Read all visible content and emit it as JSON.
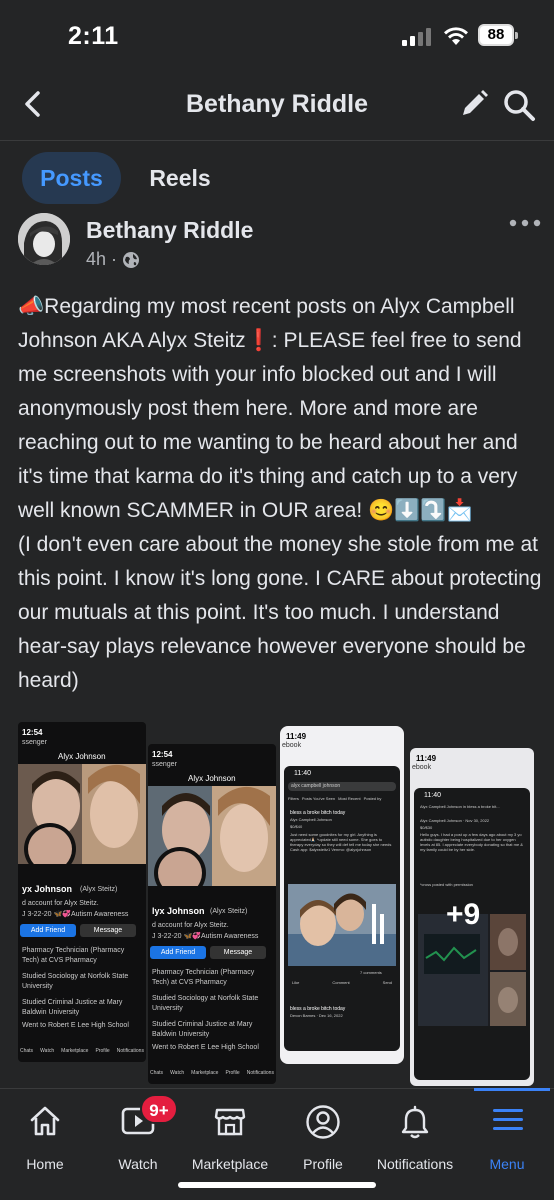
{
  "status_bar": {
    "time": "2:11",
    "battery": "88"
  },
  "header": {
    "title": "Bethany Riddle"
  },
  "tabs": [
    {
      "label": "Posts",
      "active": true
    },
    {
      "label": "Reels",
      "active": false
    }
  ],
  "post": {
    "author": "Bethany Riddle",
    "time": "4h",
    "text": "📣Regarding my most recent posts on Alyx Campbell Johnson AKA Alyx Steitz❗: PLEASE feel free to send me screenshots with your info blocked out and I will anonymously post them here. More and more are reaching out to me wanting to be heard about her and it's time that karma do it's thing and catch up to a very well known SCAMMER in OUR area! 😊⬇️⤵️📩\n(I don't even care about the money she stole from me at this point. I know it's long gone. I CARE about protecting our mutuals at this point. It's too much. I understand hear-say plays relevance however everyone should be heard)",
    "more_photos": "+9"
  },
  "thumb1": {
    "time": "12:54",
    "app": "ssenger",
    "title": "Alyx Johnson",
    "name": "yx Johnson",
    "alias": "(Alyx Steitz)",
    "line1": "d account for Alyx Steitz.",
    "line2": "J 3-22-20 🦋💞Autism Awareness",
    "add_friend": "Add Friend",
    "message": "Message",
    "job": "Pharmacy Technician (Pharmacy Tech) at CVS Pharmacy",
    "edu1": "Studied Sociology at Norfolk State University",
    "edu2": "Studied Criminal Justice at Mary Baldwin University",
    "edu3": "Went to Robert E Lee High School",
    "nav": [
      "Chats",
      "Watch",
      "Marketplace",
      "Profile",
      "Notifications"
    ]
  },
  "thumb2": {
    "time": "12:54",
    "app": "ssenger",
    "title": "Alyx Johnson",
    "name": "lyx Johnson",
    "alias": "(Alyx Steitz)",
    "line1": "d account for Alyx Steitz.",
    "line2": "J 3-22-20 🦋💞Autism Awareness",
    "add_friend": "Add Friend",
    "message": "Message",
    "job": "Pharmacy Technician (Pharmacy Tech) at CVS Pharmacy",
    "edu1": "Studied Sociology at Norfolk State University",
    "edu2": "Studied Criminal Justice at Mary Baldwin University",
    "edu3": "Went to Robert E Lee High School",
    "nav": [
      "Chats",
      "Watch",
      "Marketplace",
      "Profile",
      "Notifications"
    ]
  },
  "thumb3": {
    "time": "11:49",
    "app": "ebook",
    "inner_time": "11:40",
    "search": "alyx campbell johnson",
    "filters": [
      "Filters",
      "Posts You've Seen",
      "Most Recent",
      "Posted by"
    ],
    "post_title": "bless a broke bitch today",
    "post_author": "Alyx Campbell Johnson",
    "post_amount": "$0/$40",
    "post_body": "Just need some goodnites for my girl. Anything is appreciated🙏🏻 *update still need some. She goes to therapy everyday so they will def tell me today she needs Cash app: $alyxsteitz1 Venmo: @alyxjohnson",
    "comments": "7 comments",
    "actions": [
      "Like",
      "Comment",
      "Send"
    ],
    "post2_title": "bless a broke bitch today",
    "post2_meta": "Devon Barnes · Dec 16, 2022"
  },
  "thumb4": {
    "time": "11:49",
    "app": "ebook",
    "inner_time": "11:40",
    "header": "Alyx Campbell Johnson in bless a broke bit...",
    "author": "Alyx Campbell Johnson · Nov 30, 2022",
    "amount": "$0/$30",
    "body": "Hello guys. I had a post up a few days ago about my 3 yo autistic daughter being hospitalized due to her oxygen levels at 85. I appreciate everybody donating so that me & my family could be by her side.",
    "tail": "*cross posted with permission"
  },
  "nav": {
    "home": "Home",
    "watch": "Watch",
    "watch_badge": "9+",
    "marketplace": "Marketplace",
    "profile": "Profile",
    "notifications": "Notifications",
    "menu": "Menu"
  },
  "colors": {
    "accent": "#3b82f6",
    "badge": "#e41e3f",
    "background": "#242526"
  }
}
